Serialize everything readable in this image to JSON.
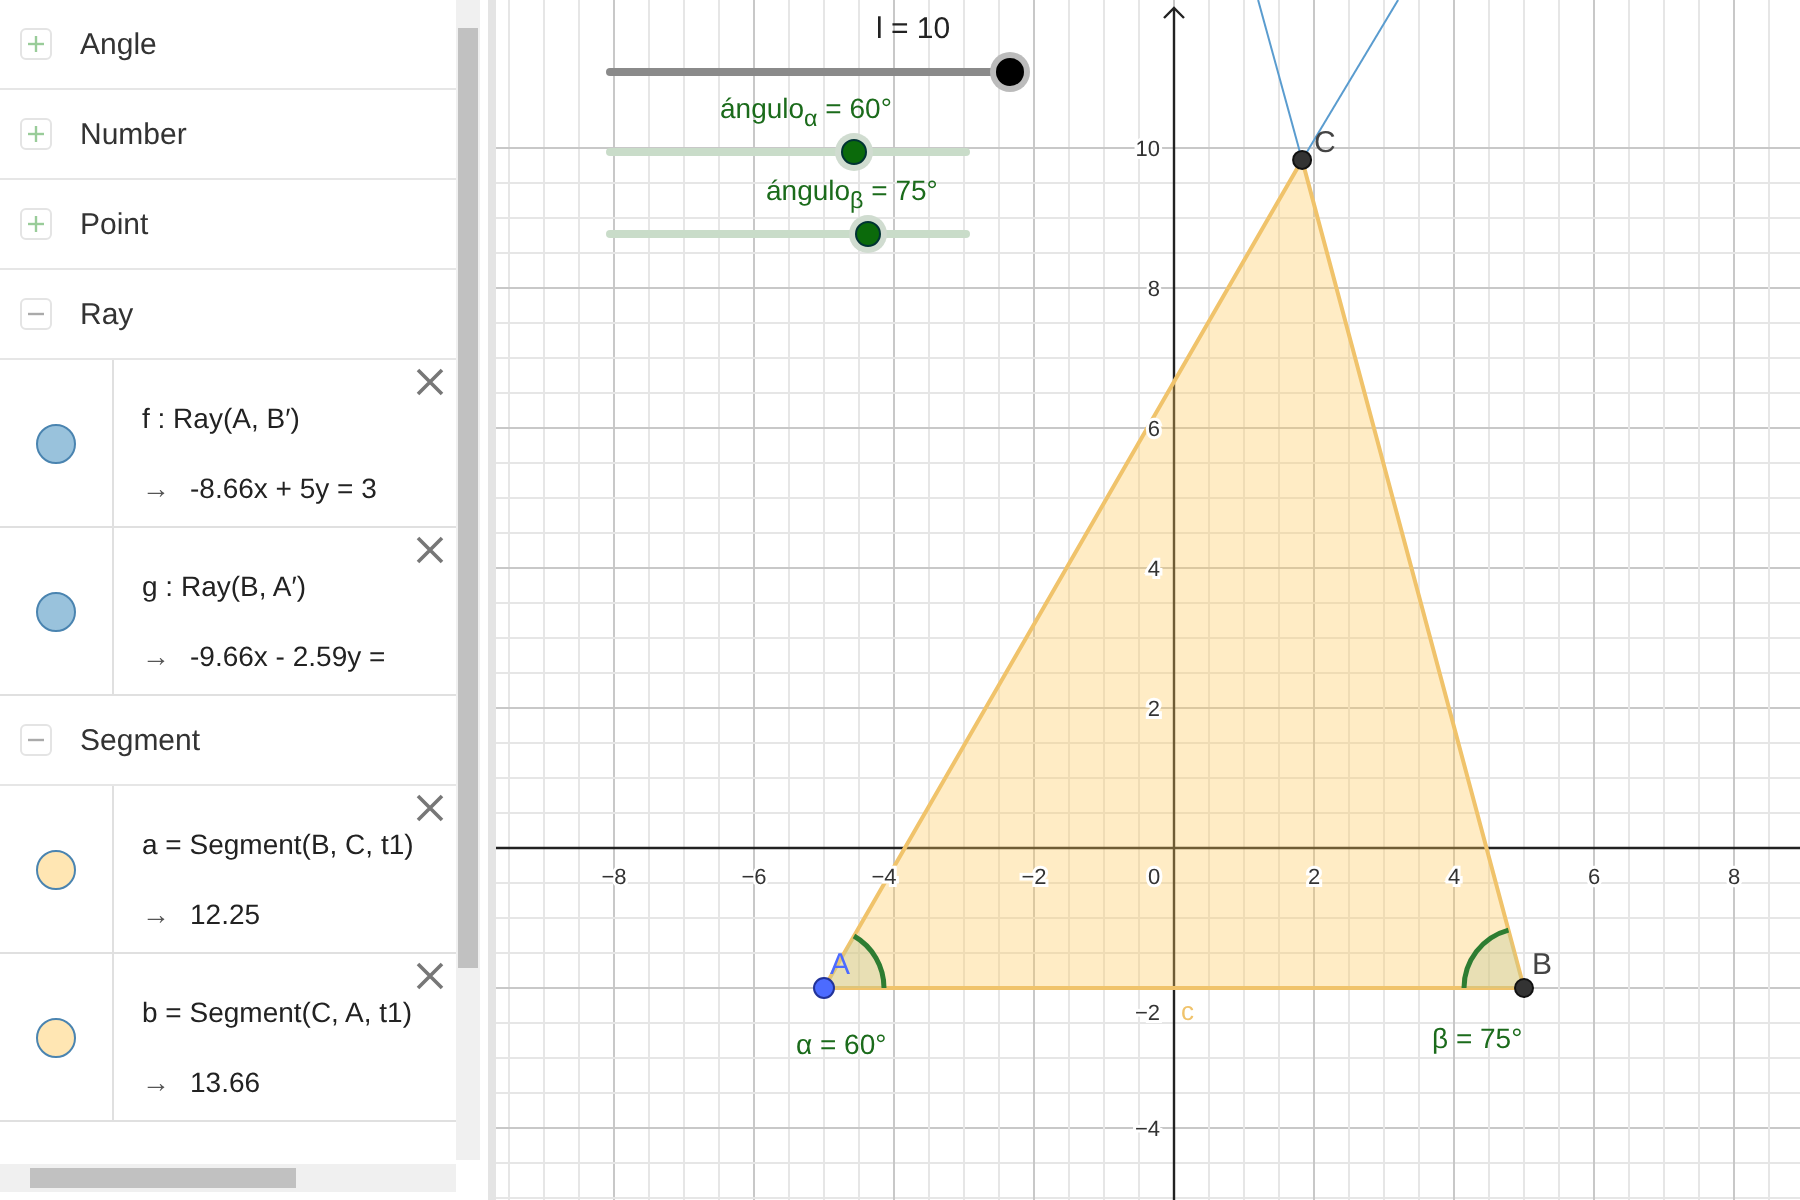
{
  "algebra": {
    "categories": [
      {
        "label": "Angle",
        "expanded": false
      },
      {
        "label": "Number",
        "expanded": false
      },
      {
        "label": "Point",
        "expanded": false
      },
      {
        "label": "Ray",
        "expanded": true,
        "items": [
          {
            "definition": "f : Ray(A, B′)",
            "value": "-8.66x + 5y = 3",
            "color": "#99c2dc"
          },
          {
            "definition": "g : Ray(B, A′)",
            "value": "-9.66x - 2.59y =",
            "color": "#99c2dc"
          }
        ]
      },
      {
        "label": "Segment",
        "expanded": true,
        "items": [
          {
            "definition": "a = Segment(B, C, t1)",
            "value": "12.25",
            "color": "#ffe6b3"
          },
          {
            "definition": "b = Segment(C, A, t1)",
            "value": "13.66",
            "color": "#ffe6b3"
          }
        ]
      }
    ],
    "arrow": "→"
  },
  "graphics": {
    "sliders": [
      {
        "label": "l = 10",
        "level": 1.0,
        "kind": "main"
      },
      {
        "label": "ángulo$_{α}$ = 60°",
        "level": 0.68,
        "kind": "angle"
      },
      {
        "label": "ángulo$_{β}$ = 75°",
        "level": 0.72,
        "kind": "angle"
      }
    ],
    "x_ticks": [
      "−8",
      "−6",
      "−4",
      "−2",
      "0",
      "2",
      "4",
      "6",
      "8"
    ],
    "y_ticks": [
      "10",
      "8",
      "6",
      "4",
      "2",
      "−2",
      "−4"
    ],
    "point_labels": [
      "A",
      "B",
      "C"
    ],
    "segment_label": "c",
    "angle_labels": [
      "α = 60°",
      "β = 75°"
    ]
  }
}
